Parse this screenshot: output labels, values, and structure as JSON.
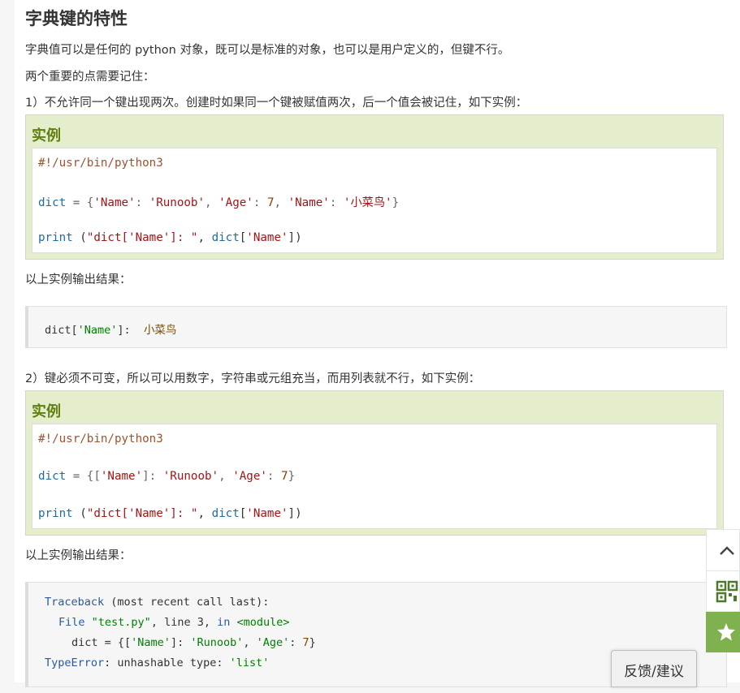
{
  "heading": "字典键的特性",
  "intro": "字典值可以是任何的 python 对象，既可以是标准的对象，也可以是用户定义的，但键不行。",
  "points_intro": "两个重要的点需要记住：",
  "point1": "1）不允许同一个键出现两次。创建时如果同一个键被赋值两次，后一个值会被记住，如下实例：",
  "point2": "2）键必须不可变，所以可以用数字，字符串或元组充当，而用列表就不行，如下实例：",
  "example_label": "实例",
  "output_label": "以上实例输出结果：",
  "example1": {
    "shebang": "#!/usr/bin/python3",
    "dict_var": "dict",
    "eq": " = {",
    "k1": "'Name'",
    "v1": "'Runoob'",
    "k2": "'Age'",
    "v2": "7",
    "k3": "'Name'",
    "v3": "'小菜鸟'",
    "print_kw": "print",
    "print_str": "\"dict['Name']: \"",
    "idx": "'Name'"
  },
  "output1": {
    "prefix": "dict[",
    "key": "'Name'",
    "suffix": "]:  ",
    "value": "小菜鸟"
  },
  "example2": {
    "shebang": "#!/usr/bin/python3",
    "dict_var": "dict",
    "k1": "'Name'",
    "v1": "'Runoob'",
    "k2": "'Age'",
    "v2": "7",
    "print_kw": "print",
    "print_str": "\"dict['Name']: \"",
    "idx": "'Name'"
  },
  "output2": {
    "tb": "Traceback",
    "tb_rest": " (most recent call last):",
    "file_kw": "File",
    "file_name": "\"test.py\"",
    "line_txt": ", line 3, ",
    "in_kw": "in",
    "module": "<module>",
    "dict_line_a": "dict = {[",
    "k1": "'Name'",
    "dict_line_b": "]: ",
    "v1": "'Runoob'",
    "comma": ", ",
    "k2": "'Age'",
    "colon": ": ",
    "v2": "7",
    "close": "}",
    "err_cls": "TypeError",
    "err_mid": ": unhashable type: ",
    "err_val": "'list'"
  },
  "sidebar": {
    "up_icon": "chevron-up-icon",
    "qr_icon": "qrcode-icon",
    "fav_icon": "star-icon",
    "fav_color": "#7fb24f"
  },
  "feedback_label": "反馈/建议"
}
